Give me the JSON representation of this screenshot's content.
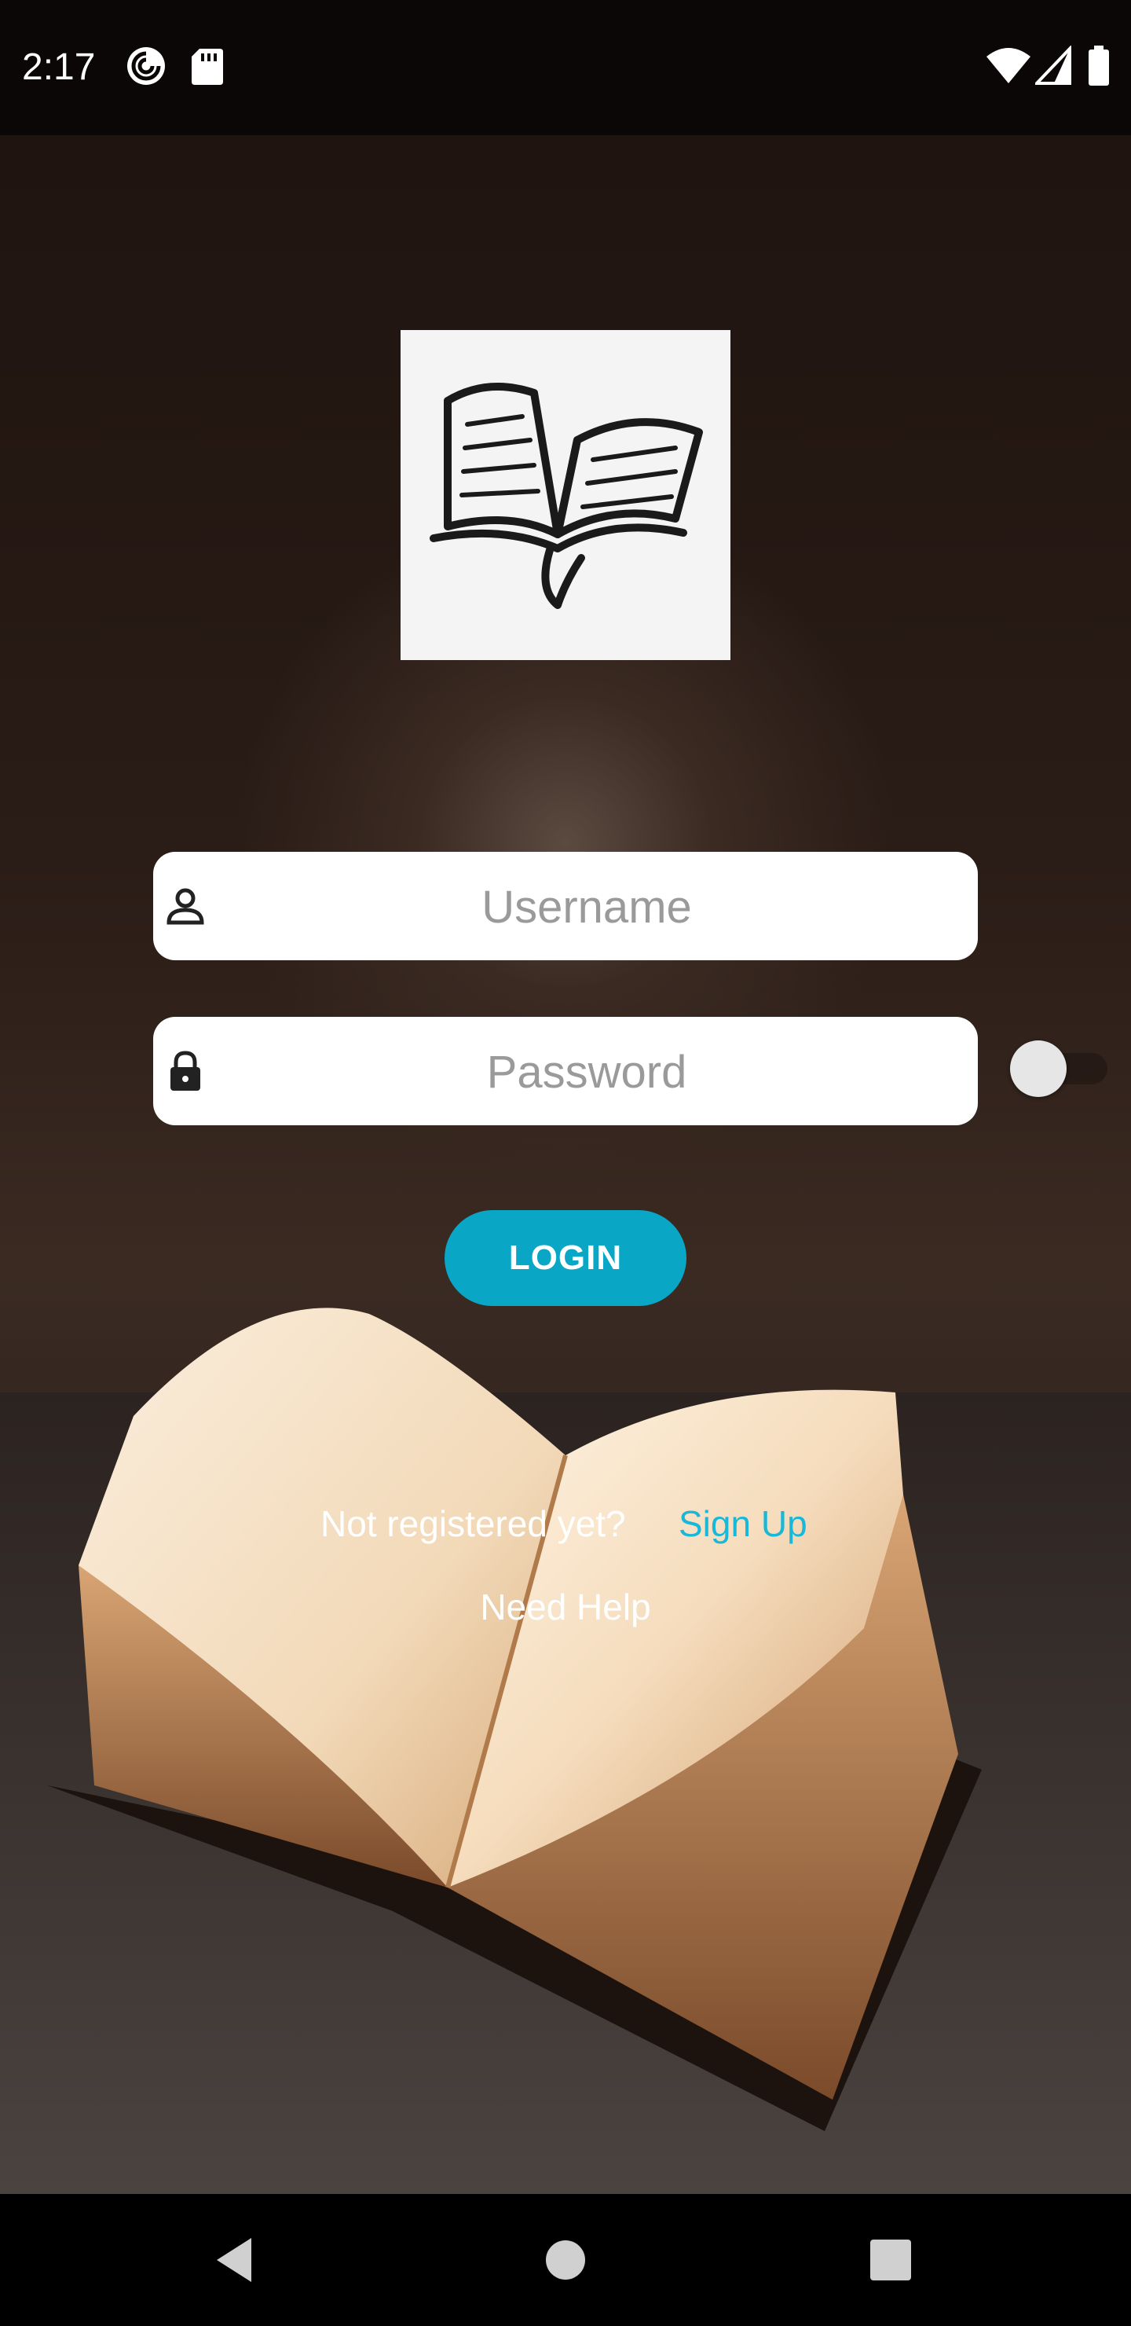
{
  "status_bar": {
    "time": "2:17",
    "left_icons": [
      "pocket-casts-icon",
      "sd-card-icon"
    ],
    "right_icons": [
      "wifi-icon",
      "cell-signal-icon",
      "battery-icon"
    ]
  },
  "logo": {
    "icon": "open-book-icon"
  },
  "form": {
    "username_placeholder": "Username",
    "username_value": "",
    "password_placeholder": "Password",
    "password_value": "",
    "username_icon": "person-icon",
    "password_icon": "lock-icon"
  },
  "login_label": "LOGIN",
  "signup_prompt": "Not registered yet?",
  "signup_link": "Sign Up",
  "help_link": "Need Help",
  "colors": {
    "accent": "#0aa6c6",
    "link": "#19b8d8"
  },
  "nav": {
    "icons": [
      "back-icon",
      "home-icon",
      "recents-icon"
    ]
  }
}
